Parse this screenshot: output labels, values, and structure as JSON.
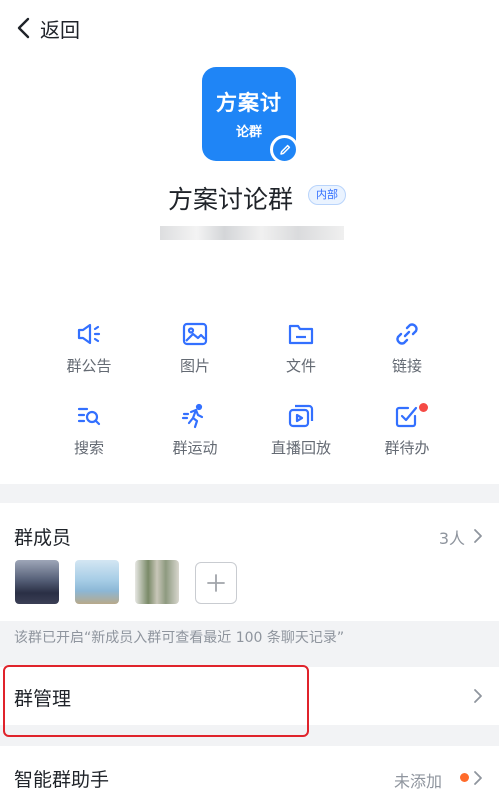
{
  "nav": {
    "back_label": "返回"
  },
  "group": {
    "avatar_line1": "方案讨",
    "avatar_line2": "论群",
    "name": "方案讨论群",
    "tag": "内部"
  },
  "actions": [
    {
      "label": "群公告",
      "icon": "announcement-icon"
    },
    {
      "label": "图片",
      "icon": "image-icon"
    },
    {
      "label": "文件",
      "icon": "folder-icon"
    },
    {
      "label": "链接",
      "icon": "link-icon"
    },
    {
      "label": "搜索",
      "icon": "search-list-icon"
    },
    {
      "label": "群运动",
      "icon": "running-icon"
    },
    {
      "label": "直播回放",
      "icon": "live-replay-icon"
    },
    {
      "label": "群待办",
      "icon": "todo-check-icon"
    }
  ],
  "members": {
    "title": "群成员",
    "count": "3人"
  },
  "notice": "该群已开启“新成员入群可查看最近 100 条聊天记录”",
  "manage": {
    "label": "群管理"
  },
  "assistant": {
    "label": "智能群助手",
    "status": "未添加"
  },
  "colors": {
    "accent": "#1f85f6",
    "highlight": "#e0232b",
    "badge_red": "#f54a45",
    "badge_orange": "#ff6b2b"
  }
}
